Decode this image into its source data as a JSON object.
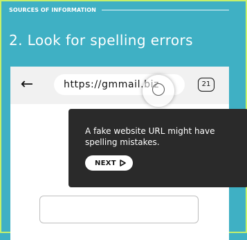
{
  "section": {
    "label": "SOURCES OF INFORMATION"
  },
  "headline": "2. Look for spelling errors",
  "browser": {
    "url": "https://gmmail.biz",
    "tab_count": "21",
    "back_icon": "back-arrow-icon",
    "magnifier_icon": "magnifier-icon"
  },
  "tooltip": {
    "text": "A fake website URL might have spelling mistakes.",
    "next_label": "NEXT",
    "next_icon": "play-outline-icon"
  },
  "colors": {
    "background": "#3fb0c4",
    "frame": "#c6f06a",
    "tooltip_bg": "#2a2a2a"
  }
}
